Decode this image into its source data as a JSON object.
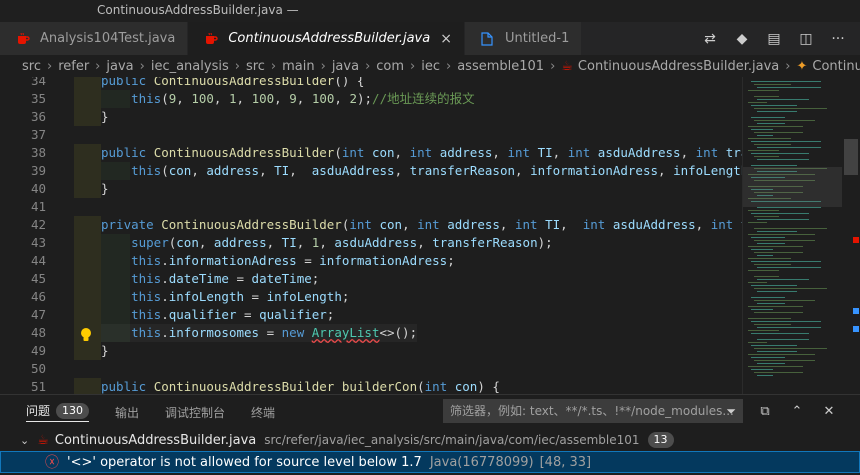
{
  "window": {
    "title": "ContinuousAddressBuilder.java —"
  },
  "tabs": [
    {
      "label": "Analysis104Test.java",
      "icon": "java-icon",
      "active": false
    },
    {
      "label": "ContinuousAddressBuilder.java",
      "icon": "java-icon",
      "active": true,
      "close": "×"
    },
    {
      "label": "Untitled-1",
      "icon": "file-icon",
      "active": false
    }
  ],
  "breadcrumb": [
    "src",
    "refer",
    "java",
    "iec_analysis",
    "src",
    "main",
    "java",
    "com",
    "iec",
    "assemble101",
    "ContinuousAddressBuilder.java",
    "ContinuousAdd"
  ],
  "editor": {
    "line_numbers": [
      "34",
      "35",
      "36",
      "37",
      "38",
      "39",
      "40",
      "41",
      "42",
      "43",
      "44",
      "45",
      "46",
      "47",
      "48",
      "49",
      "50",
      "51"
    ],
    "lines": [
      "public ContinuousAddressBuilder() {",
      "    this(9, 100, 1, 100, 9, 100, 2);//地址连续的报文",
      "}",
      "",
      "public ContinuousAddressBuilder(int con, int address, int TI, int asduAddress, int transf",
      "    this(con, address, TI,  asduAddress, transferReason, informationAdress, infoLength, r",
      "}",
      "",
      "private ContinuousAddressBuilder(int con, int address, int TI,  int asduAddress, int tran",
      "    super(con, address, TI, 1, asduAddress, transferReason);",
      "    this.informationAdress = informationAdress;",
      "    this.dateTime = dateTime;",
      "    this.infoLength = infoLength;",
      "    this.qualifier = qualifier;",
      "    this.informosomes = new ArrayList<>();",
      "}",
      "",
      "public ContinuousAddressBuilder builderCon(int con) {"
    ]
  },
  "panel": {
    "tabs": [
      {
        "label": "问题",
        "badge": "130",
        "active": true
      },
      {
        "label": "输出"
      },
      {
        "label": "调试控制台"
      },
      {
        "label": "终端"
      }
    ],
    "filter_placeholder": "筛选器，例如: text、**/*.ts、!**/node_modules...",
    "file": {
      "name": "ContinuousAddressBuilder.java",
      "path": "src/refer/java/iec_analysis/src/main/java/com/iec/assemble101",
      "count": "13"
    },
    "error": {
      "message": "'<>' operator is not allowed for source level below 1.7",
      "source": "Java(16778099)",
      "location": "[48, 33]"
    }
  },
  "colors": {
    "accent": "#04395e",
    "java": "#e51400",
    "error": "#f14c4c",
    "link": "#3794ff"
  }
}
